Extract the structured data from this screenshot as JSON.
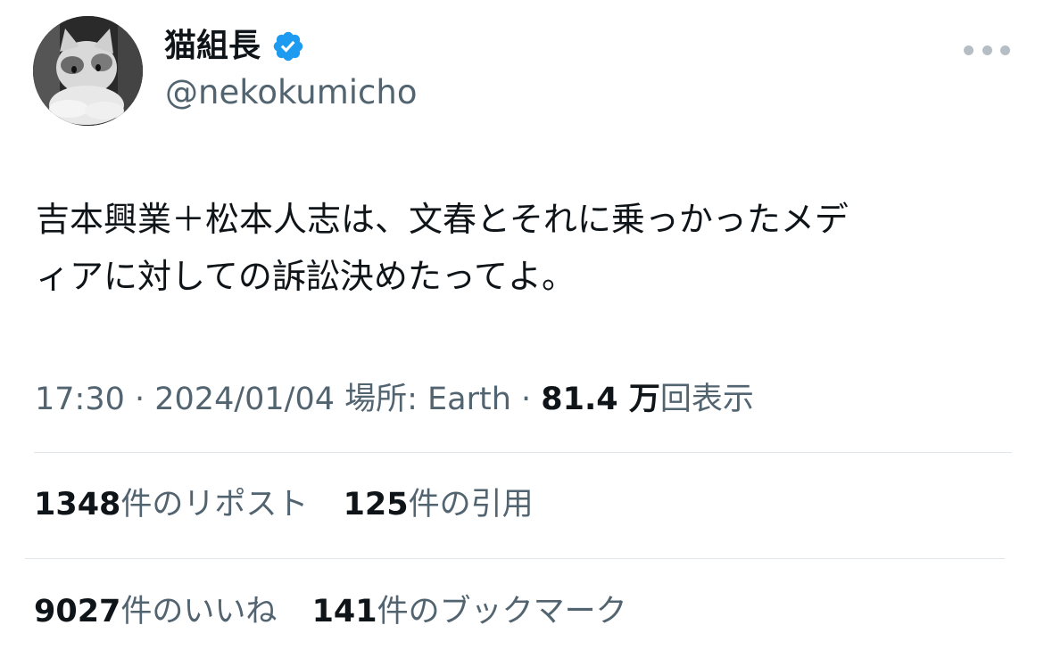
{
  "author": {
    "display_name": "猫組長",
    "handle": "@nekokumicho",
    "verified_color": "#1d9bf0",
    "avatar_description_icon": "cat-avatar"
  },
  "more_icon": "ellipsis-icon",
  "tweet": {
    "text": "吉本興業＋松本人志は、文春とそれに乗っかったメデ\nィアに対しての訴訟決めたってよ。"
  },
  "meta": {
    "time": "17:30",
    "sep1": " · ",
    "date": "2024/01/04",
    "location_label": " 場所: Earth",
    "sep2": " · ",
    "views_count": "81.4 万",
    "views_label": "回表示"
  },
  "stats": {
    "reposts": {
      "count": "1348",
      "label": "件のリポスト"
    },
    "quotes": {
      "count": "125",
      "label": "件の引用"
    },
    "likes": {
      "count": "9027",
      "label": "件のいいね"
    },
    "bookmarks": {
      "count": "141",
      "label": "件のブックマーク"
    }
  },
  "colors": {
    "text_primary": "#0f1419",
    "text_secondary": "#536471",
    "divider": "#e1e6ea"
  }
}
